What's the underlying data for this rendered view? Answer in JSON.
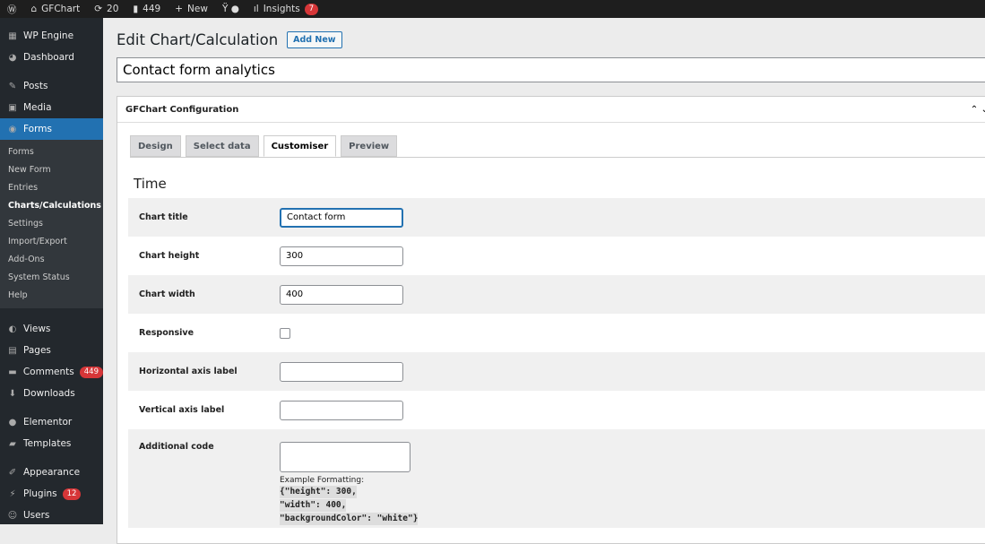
{
  "adminbar": {
    "site": "GFChart",
    "updates": "20",
    "comments": "449",
    "new": "New",
    "insights": "Insights",
    "insights_badge": "7"
  },
  "sidebar": {
    "items": [
      {
        "label": "WP Engine",
        "icon": "grid-icon"
      },
      {
        "label": "Dashboard",
        "icon": "dashboard-icon"
      },
      {
        "label": "Posts",
        "icon": "pin-icon"
      },
      {
        "label": "Media",
        "icon": "media-icon"
      },
      {
        "label": "Forms",
        "icon": "forms-icon"
      }
    ],
    "submenu": [
      "Forms",
      "New Form",
      "Entries",
      "Charts/Calculations",
      "Settings",
      "Import/Export",
      "Add-Ons",
      "System Status",
      "Help"
    ],
    "items2": [
      {
        "label": "Views",
        "icon": "eye-icon"
      },
      {
        "label": "Pages",
        "icon": "page-icon"
      },
      {
        "label": "Comments",
        "icon": "comment-icon",
        "badge": "449"
      },
      {
        "label": "Downloads",
        "icon": "download-icon"
      },
      {
        "label": "Elementor",
        "icon": "elementor-icon"
      },
      {
        "label": "Templates",
        "icon": "folder-icon"
      },
      {
        "label": "Appearance",
        "icon": "brush-icon"
      },
      {
        "label": "Plugins",
        "icon": "plugin-icon",
        "badge": "12"
      },
      {
        "label": "Users",
        "icon": "user-icon"
      }
    ]
  },
  "page": {
    "title": "Edit Chart/Calculation",
    "add_new": "Add New",
    "post_title": "Contact form analytics",
    "box_title": "GFChart Configuration",
    "tabs": [
      "Design",
      "Select data",
      "Customiser",
      "Preview"
    ],
    "active_tab": "Customiser",
    "section": "Time",
    "fields": {
      "chart_title_label": "Chart title",
      "chart_title": "Contact form",
      "height_label": "Chart height",
      "height": "300",
      "width_label": "Chart width",
      "width": "400",
      "responsive_label": "Responsive",
      "haxis_label": "Horizontal axis label",
      "vaxis_label": "Vertical axis label",
      "code_label": "Additional code",
      "example": "Example Formatting:",
      "code1": "{\"height\": 300,",
      "code2": "\"width\": 400,",
      "code3": "\"backgroundColor\": \"white\"}"
    }
  }
}
